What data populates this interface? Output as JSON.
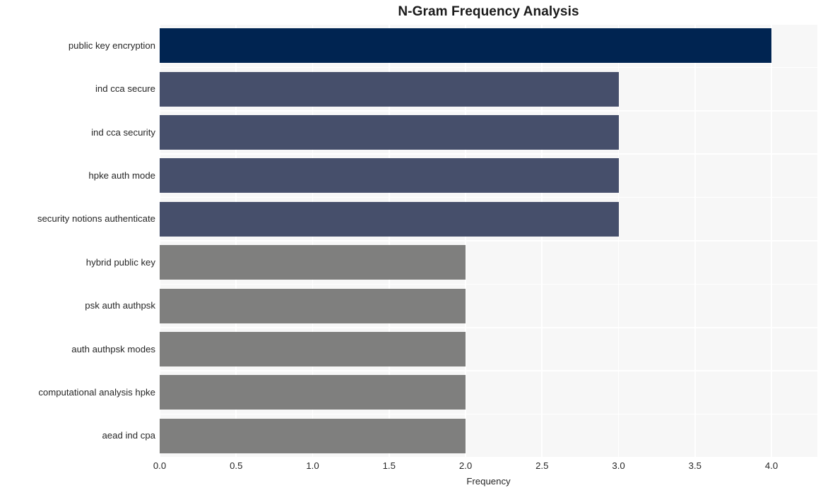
{
  "chart_data": {
    "type": "bar",
    "orientation": "horizontal",
    "title": "N-Gram Frequency Analysis",
    "xlabel": "Frequency",
    "ylabel": "",
    "categories": [
      "public key encryption",
      "ind cca secure",
      "ind cca security",
      "hpke auth mode",
      "security notions authenticate",
      "hybrid public key",
      "psk auth authpsk",
      "auth authpsk modes",
      "computational analysis hpke",
      "aead ind cpa"
    ],
    "values": [
      4,
      3,
      3,
      3,
      3,
      2,
      2,
      2,
      2,
      2
    ],
    "bar_colors": [
      "#002451",
      "#464f6b",
      "#464f6b",
      "#464f6b",
      "#464f6b",
      "#7f7f7e",
      "#7f7f7e",
      "#7f7f7e",
      "#7f7f7e",
      "#7f7f7e"
    ],
    "xlim": [
      0.0,
      4.3
    ],
    "xticks": [
      "0.0",
      "0.5",
      "1.0",
      "1.5",
      "2.0",
      "2.5",
      "3.0",
      "3.5",
      "4.0"
    ],
    "xtick_values": [
      0.0,
      0.5,
      1.0,
      1.5,
      2.0,
      2.5,
      3.0,
      3.5,
      4.0
    ],
    "grid": true,
    "legend": "none",
    "plot_background": "#f7f7f7",
    "grid_color": "#ffffff",
    "figure_background": "#ffffff",
    "text_color": "#262626",
    "title_color": "#1a1a1a"
  }
}
